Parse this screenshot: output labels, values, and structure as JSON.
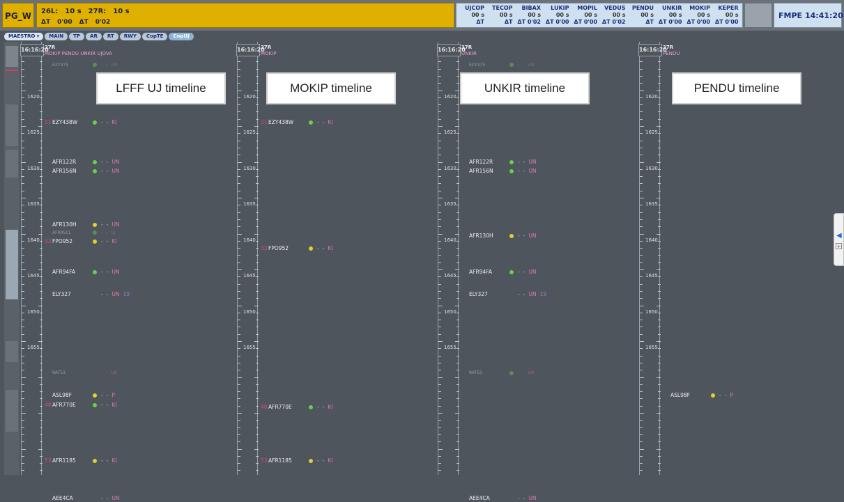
{
  "header": {
    "sector": "PG_W",
    "runway": {
      "r1": [
        {
          "name": "26L:",
          "val": "10 s"
        },
        {
          "name": "27R:",
          "val": "10 s"
        }
      ],
      "r2": [
        {
          "name": "ΔT",
          "val": "0'00"
        },
        {
          "name": "ΔT",
          "val": "0'02"
        }
      ]
    },
    "fixes": [
      {
        "name": "UJCOP",
        "sec": "00 s",
        "dt": "ΔT"
      },
      {
        "name": "TECOP",
        "sec": "00 s",
        "dt": "ΔT"
      },
      {
        "name": "BIBAX",
        "sec": "00 s",
        "dt": "ΔT 0'02"
      },
      {
        "name": "LUKIP",
        "sec": "00 s",
        "dt": "ΔT 0'00"
      },
      {
        "name": "MOPIL",
        "sec": "00 s",
        "dt": "ΔT 0'00"
      },
      {
        "name": "VEDUS",
        "sec": "00 s",
        "dt": "ΔT 0'02"
      },
      {
        "name": "PENDU",
        "sec": "00 s",
        "dt": "ΔT"
      },
      {
        "name": "UNKIR",
        "sec": "00 s",
        "dt": "ΔT 0'00"
      },
      {
        "name": "MOKIP",
        "sec": "00 s",
        "dt": "ΔT 0'00"
      },
      {
        "name": "KEPER",
        "sec": "00 s",
        "dt": "ΔT 0'00"
      }
    ],
    "unit": "FMPE",
    "clock": "14:41:20"
  },
  "tabs": [
    "MAESTRO ▾",
    "MAIN",
    "TP",
    "AR",
    "RT",
    "RWY",
    "CopTE",
    "CopUJ"
  ],
  "scale": {
    "head": "16:16:20",
    "labels": [
      "1620",
      "1625",
      "1630",
      "1635",
      "1640",
      "1645",
      "1650",
      "1655"
    ]
  },
  "timelines": [
    {
      "overlay": "LFFF UJ timeline",
      "runway": "27R",
      "fixes": "MOKIP PENDU UNKIR UJOVA",
      "flights": [
        {
          "t": 0.5,
          "num": "",
          "cs": "EZY375",
          "dot": "#6ad04a",
          "dest": "UN",
          "faint": true
        },
        {
          "t": 8.5,
          "num": "21",
          "cs": "EZY438W",
          "dot": "#6ad04a",
          "dest": "KI"
        },
        {
          "t": 14.0,
          "num": "",
          "cs": "AFR122R",
          "dot": "#6ad04a",
          "dest": "UN"
        },
        {
          "t": 15.3,
          "num": "",
          "cs": "AFR156N",
          "dot": "#6ad04a",
          "dest": "UN"
        },
        {
          "t": 22.8,
          "num": "",
          "cs": "AFR130H",
          "dot": "#e0d030",
          "dest": "UN"
        },
        {
          "t": 23.9,
          "num": "",
          "cs": "AFR95CL",
          "dot": "#6ad04a",
          "dest": "UJ",
          "faint": true
        },
        {
          "t": 25.1,
          "num": "33",
          "cs": "FPO952",
          "dot": "#e0d030",
          "dest": "KI"
        },
        {
          "t": 29.4,
          "num": "",
          "cs": "AFR94FA",
          "dot": "#6ad04a",
          "dest": "UN"
        },
        {
          "t": 32.5,
          "num": "",
          "cs": "ELY327",
          "dot": "",
          "dest": "UN",
          "extra": "19"
        },
        {
          "t": 43.5,
          "num": "",
          "cs": "RAT53",
          "dot": "",
          "dest": "UN",
          "faint": true
        },
        {
          "t": 46.6,
          "num": "",
          "cs": "ASL98F",
          "dot": "#e0d030",
          "dest": "P"
        },
        {
          "t": 47.9,
          "num": "48",
          "cs": "AFR770E",
          "dot": "#6ad04a",
          "dest": "KI"
        },
        {
          "t": 55.7,
          "num": "53",
          "cs": "AFR1185",
          "dot": "#e0d030",
          "dest": "KI"
        },
        {
          "t": 60.9,
          "num": "",
          "cs": "AEE4CA",
          "dot": "",
          "dest": "UN"
        }
      ]
    },
    {
      "overlay": "MOKIP timeline",
      "runway": "27R",
      "fixes": "MOKIP",
      "flights": [
        {
          "t": 8.5,
          "num": "21",
          "cs": "EZY438W",
          "dot": "#6ad04a",
          "dest": "KI"
        },
        {
          "t": 26.1,
          "num": "33",
          "cs": "FPO952",
          "dot": "#e0d030",
          "dest": "KI"
        },
        {
          "t": 48.2,
          "num": "48",
          "cs": "AFR770E",
          "dot": "#6ad04a",
          "dest": "KI"
        },
        {
          "t": 55.7,
          "num": "53",
          "cs": "AFR1185",
          "dot": "#e0d030",
          "dest": "KI"
        }
      ]
    },
    {
      "overlay": "UNKIR timeline",
      "runway": "27R",
      "fixes": "UNKIR",
      "flights": [
        {
          "t": 0.5,
          "num": "",
          "cs": "EZY375",
          "dot": "#6ad04a",
          "dest": "UN",
          "faint": true
        },
        {
          "t": 14.0,
          "num": "",
          "cs": "AFR122R",
          "dot": "#6ad04a",
          "dest": "UN"
        },
        {
          "t": 15.3,
          "num": "",
          "cs": "AFR156N",
          "dot": "#6ad04a",
          "dest": "UN"
        },
        {
          "t": 24.3,
          "num": "",
          "cs": "AFR130H",
          "dot": "#e0d030",
          "dest": "UN"
        },
        {
          "t": 29.4,
          "num": "",
          "cs": "AFR94FA",
          "dot": "#6ad04a",
          "dest": "UN"
        },
        {
          "t": 32.5,
          "num": "",
          "cs": "ELY327",
          "dot": "",
          "dest": "UN",
          "extra": "19"
        },
        {
          "t": 43.5,
          "num": "",
          "cs": "RAT53",
          "dot": "#6ad04a",
          "dest": "UN",
          "faint": true
        },
        {
          "t": 60.9,
          "num": "",
          "cs": "AEE4CA",
          "dot": "",
          "dest": "UN"
        }
      ]
    },
    {
      "overlay": "PENDU timeline",
      "runway": "27R",
      "fixes": "PENDU",
      "flights": [
        {
          "t": 46.6,
          "num": "",
          "cs": "ASL98F",
          "dot": "#e0d030",
          "dest": "P"
        }
      ]
    }
  ]
}
